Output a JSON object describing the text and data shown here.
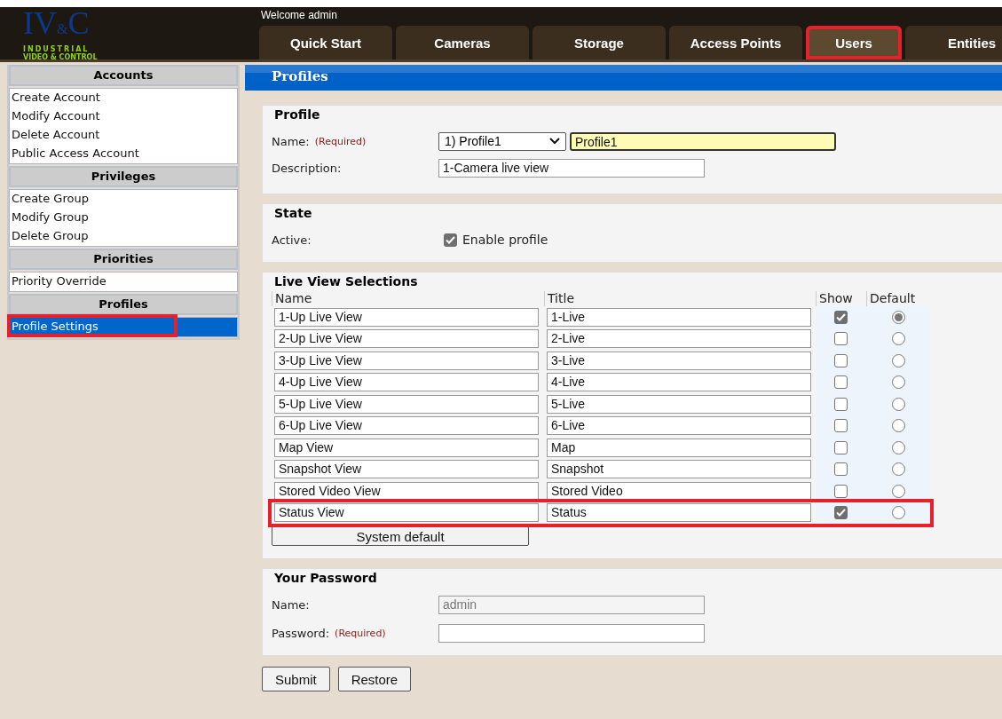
{
  "header": {
    "logo": {
      "letters": "IV",
      "amp": "&",
      "last": "C",
      "line1": "INDUSTRIAL",
      "line2": "VIDEO & CONTROL"
    },
    "welcome": "Welcome admin"
  },
  "tabs": [
    {
      "label": "Quick Start",
      "selected": false,
      "highlighted": false
    },
    {
      "label": "Cameras",
      "selected": false,
      "highlighted": false
    },
    {
      "label": "Storage",
      "selected": false,
      "highlighted": false
    },
    {
      "label": "Access Points",
      "selected": false,
      "highlighted": false
    },
    {
      "label": "Users",
      "selected": true,
      "highlighted": true
    },
    {
      "label": "Entities",
      "selected": false,
      "highlighted": false
    }
  ],
  "sidebar": [
    {
      "title": "Accounts",
      "items": [
        {
          "label": "Create Account",
          "selected": false,
          "highlighted": false
        },
        {
          "label": "Modify Account",
          "selected": false,
          "highlighted": false
        },
        {
          "label": "Delete Account",
          "selected": false,
          "highlighted": false
        },
        {
          "label": "Public Access Account",
          "selected": false,
          "highlighted": false
        }
      ]
    },
    {
      "title": "Privileges",
      "items": [
        {
          "label": "Create Group",
          "selected": false,
          "highlighted": false
        },
        {
          "label": "Modify Group",
          "selected": false,
          "highlighted": false
        },
        {
          "label": "Delete Group",
          "selected": false,
          "highlighted": false
        }
      ]
    },
    {
      "title": "Priorities",
      "items": [
        {
          "label": "Priority Override",
          "selected": false,
          "highlighted": false
        }
      ]
    },
    {
      "title": "Profiles",
      "items": [
        {
          "label": "Profile Settings",
          "selected": true,
          "highlighted": true
        }
      ]
    }
  ],
  "page_title": "Profiles",
  "profile": {
    "legend": "Profile",
    "name_label": "Name:",
    "required": "(Required)",
    "select_value": "1) Profile1",
    "name_value": "Profile1",
    "description_label": "Description:",
    "description_value": "1-Camera live view"
  },
  "state": {
    "legend": "State",
    "active_label": "Active:",
    "checkbox_label": "Enable profile",
    "checked": true
  },
  "live_view": {
    "legend": "Live View Selections",
    "columns": [
      "Name",
      "Title",
      "Show",
      "Default"
    ],
    "rows": [
      {
        "name": "1-Up Live View",
        "title": "1-Live",
        "show": true,
        "default": true,
        "highlighted": false
      },
      {
        "name": "2-Up Live View",
        "title": "2-Live",
        "show": false,
        "default": false,
        "highlighted": false
      },
      {
        "name": "3-Up Live View",
        "title": "3-Live",
        "show": false,
        "default": false,
        "highlighted": false
      },
      {
        "name": "4-Up Live View",
        "title": "4-Live",
        "show": false,
        "default": false,
        "highlighted": false
      },
      {
        "name": "5-Up Live View",
        "title": "5-Live",
        "show": false,
        "default": false,
        "highlighted": false
      },
      {
        "name": "6-Up Live View",
        "title": "6-Live",
        "show": false,
        "default": false,
        "highlighted": false
      },
      {
        "name": "Map View",
        "title": "Map",
        "show": false,
        "default": false,
        "highlighted": false
      },
      {
        "name": "Snapshot View",
        "title": "Snapshot",
        "show": false,
        "default": false,
        "highlighted": false
      },
      {
        "name": "Stored Video View",
        "title": "Stored Video",
        "show": false,
        "default": false,
        "highlighted": false
      },
      {
        "name": "Status View",
        "title": "Status",
        "show": true,
        "default": false,
        "highlighted": true
      }
    ],
    "button": "System default"
  },
  "password": {
    "legend": "Your Password",
    "name_label": "Name:",
    "name_value": "admin",
    "password_label": "Password:",
    "required": "(Required)"
  },
  "buttons": [
    "Submit",
    "Restore"
  ]
}
